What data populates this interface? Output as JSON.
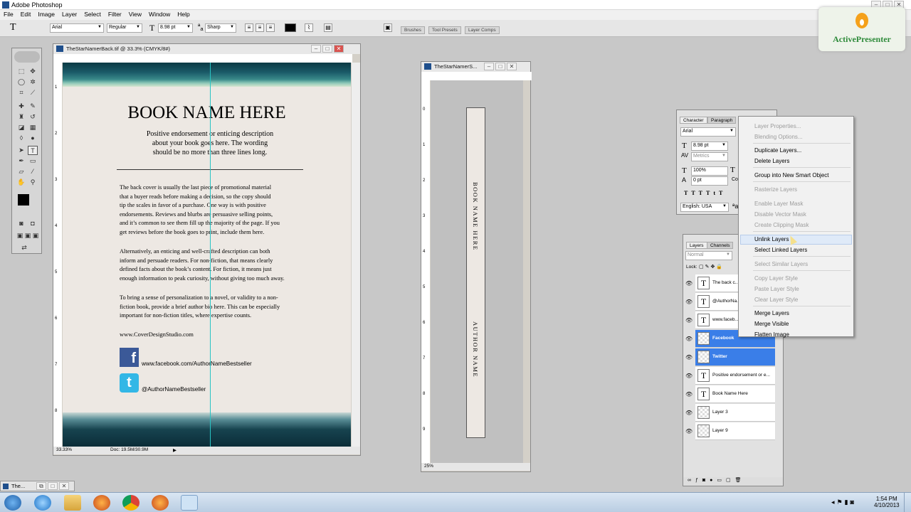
{
  "app": {
    "title": "Adobe Photoshop",
    "menu": [
      "File",
      "Edit",
      "Image",
      "Layer",
      "Select",
      "Filter",
      "View",
      "Window",
      "Help"
    ]
  },
  "options_bar": {
    "tool_glyph": "T",
    "font_family": "Arial",
    "font_style": "Regular",
    "font_size": "8.98 pt",
    "antialias": "Sharp",
    "tabs": [
      "Brushes",
      "Tool Presets",
      "Layer Comps"
    ]
  },
  "logo": {
    "text": "ActivePresenter"
  },
  "doc_main": {
    "title": "TheStarNamerBack.tif @ 33.3% (CMYK/8#)",
    "zoom": "33.33%",
    "doc_size": "Doc: 19.5M/30.9M",
    "book_title": "BOOK NAME HERE",
    "endorse_1": "Positive endorsement or enticing description",
    "endorse_2": "about your book goes here. The wording",
    "endorse_3": "should be no more than three lines long.",
    "para1": [
      "The back cover is usually the last piece of promotional material",
      "that a buyer reads before making a decision, so the copy should",
      "tip the scales in favor of a purchase. One way is with positive",
      "endorsements. Reviews and blurbs are persuasive selling points,",
      "and it’s common to see them fill up the majority of the page. If you",
      "get reviews before the book goes to print, include them here."
    ],
    "para2": [
      "Alternatively, an enticing and well-crafted description can both",
      "inform and persuade readers. For non-fiction, that means clearly",
      "defined facts about the book’s content. For fiction, it means just",
      "enough information to peak curiosity, without giving too much away."
    ],
    "para3": [
      "To bring a sense of personalization to a novel, or validity to a non-",
      "fiction book, provide a brief author bio here. This can be especially",
      "important for non-fiction titles, where expertise counts."
    ],
    "website": "www.CoverDesignStudio.com",
    "facebook": "www.facebook.com/AuthorNameBestseller",
    "twitter": "@AuthorNameBestseller",
    "ruler_marks": [
      "1",
      "2",
      "3",
      "4",
      "5",
      "6",
      "7",
      "8"
    ]
  },
  "doc_spine": {
    "title": "TheStarNamerS...",
    "zoom": "25%",
    "title_vertical": "BOOK NAME HERE",
    "author_vertical": "AUTHOR NAME",
    "ruler_marks": [
      "0",
      "1",
      "2",
      "3",
      "4",
      "5",
      "6",
      "7",
      "8",
      "9"
    ]
  },
  "character_panel": {
    "tabs": [
      "Character",
      "Paragraph"
    ],
    "font": "Arial",
    "size": "8.98 pt",
    "kerning": "Metrics",
    "scale": "100%",
    "baseline": "0 pt",
    "color_label": "Color",
    "language": "English: USA"
  },
  "layers_panel": {
    "tabs": [
      "Layers",
      "Channels"
    ],
    "blend": "Normal",
    "lock_label": "Lock:",
    "layers": [
      {
        "name": "The back c...",
        "type": "text",
        "selected": false
      },
      {
        "name": "@AuthorNa...",
        "type": "text",
        "selected": false
      },
      {
        "name": "www.faceb...",
        "type": "text",
        "selected": false
      },
      {
        "name": "Facebook",
        "type": "image",
        "selected": true
      },
      {
        "name": "Twitter",
        "type": "image",
        "selected": true
      },
      {
        "name": "Positive endorsement or e...",
        "type": "text",
        "selected": false
      },
      {
        "name": "Book Name Here",
        "type": "text",
        "selected": false
      },
      {
        "name": "Layer 3",
        "type": "image",
        "selected": false
      },
      {
        "name": "Layer 9",
        "type": "image",
        "selected": false
      }
    ]
  },
  "context_menu": {
    "items": [
      {
        "label": "Layer Properties...",
        "enabled": false
      },
      {
        "label": "Blending Options...",
        "enabled": false
      },
      {
        "label": "Duplicate Layers...",
        "enabled": true
      },
      {
        "label": "Delete Layers",
        "enabled": true
      },
      {
        "label": "Group into New Smart Object",
        "enabled": true
      },
      {
        "label": "Rasterize Layers",
        "enabled": false
      },
      {
        "label": "Enable Layer Mask",
        "enabled": false
      },
      {
        "label": "Disable Vector Mask",
        "enabled": false
      },
      {
        "label": "Create Clipping Mask",
        "enabled": false
      },
      {
        "label": "Unlink Layers",
        "enabled": true,
        "highlighted": true
      },
      {
        "label": "Select Linked Layers",
        "enabled": true
      },
      {
        "label": "Select Similar Layers",
        "enabled": false
      },
      {
        "label": "Copy Layer Style",
        "enabled": false
      },
      {
        "label": "Paste Layer Style",
        "enabled": false
      },
      {
        "label": "Clear Layer Style",
        "enabled": false
      },
      {
        "label": "Merge Layers",
        "enabled": true
      },
      {
        "label": "Merge Visible",
        "enabled": true
      },
      {
        "label": "Flatten Image",
        "enabled": true
      }
    ]
  },
  "minimized_doc": {
    "title": "The..."
  },
  "taskbar": {
    "time": "1:54 PM",
    "date": "4/10/2013"
  }
}
